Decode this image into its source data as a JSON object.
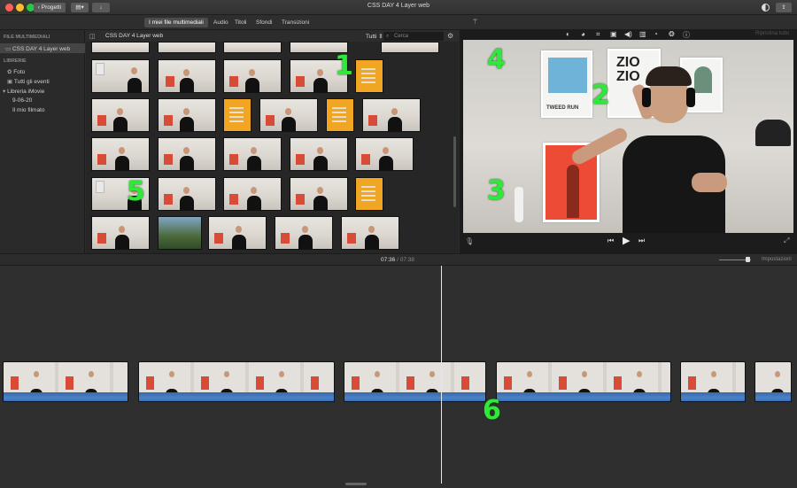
{
  "window": {
    "title": "CSS DAY 4 Layer web",
    "projects_button": "Progetti",
    "accent_colors": {
      "close": "#fe5f57",
      "minimize": "#febc2e",
      "zoom": "#28c840"
    }
  },
  "tabs": [
    {
      "label": "I miei file multimediali",
      "active": true
    },
    {
      "label": "Audio",
      "active": false
    },
    {
      "label": "Titoli",
      "active": false
    },
    {
      "label": "Sfondi",
      "active": false
    },
    {
      "label": "Transizioni",
      "active": false
    }
  ],
  "sidebar": {
    "media_header": "FILE MULTIMEDIALI",
    "project_item": "CSS DAY 4 Layer web",
    "libraries_header": "LIBRERIE",
    "items": [
      {
        "label": "Foto",
        "icon": "photos-icon"
      },
      {
        "label": "Tutti gli eventi",
        "icon": "events-icon"
      },
      {
        "label": "Libreria iMovie",
        "icon": "disclosure-icon"
      },
      {
        "label": "9-06-20",
        "icon": ""
      },
      {
        "label": "Il mio filmato",
        "icon": ""
      }
    ]
  },
  "browser": {
    "title": "CSS DAY 4 Layer web",
    "filter": "Tutti",
    "search_placeholder": "Cerca"
  },
  "viewer": {
    "reset_label": "Ripristina tutto"
  },
  "timeline": {
    "current_time": "07:36",
    "separator": "/",
    "total_time": "07:38",
    "settings_label": "Impostazioni"
  },
  "annotations": [
    "1",
    "2",
    "3",
    "4",
    "5",
    "6"
  ],
  "video_poster_text": {
    "line1": "ZIO",
    "line2": "ZIO",
    "line3": "TWEED RUN"
  }
}
